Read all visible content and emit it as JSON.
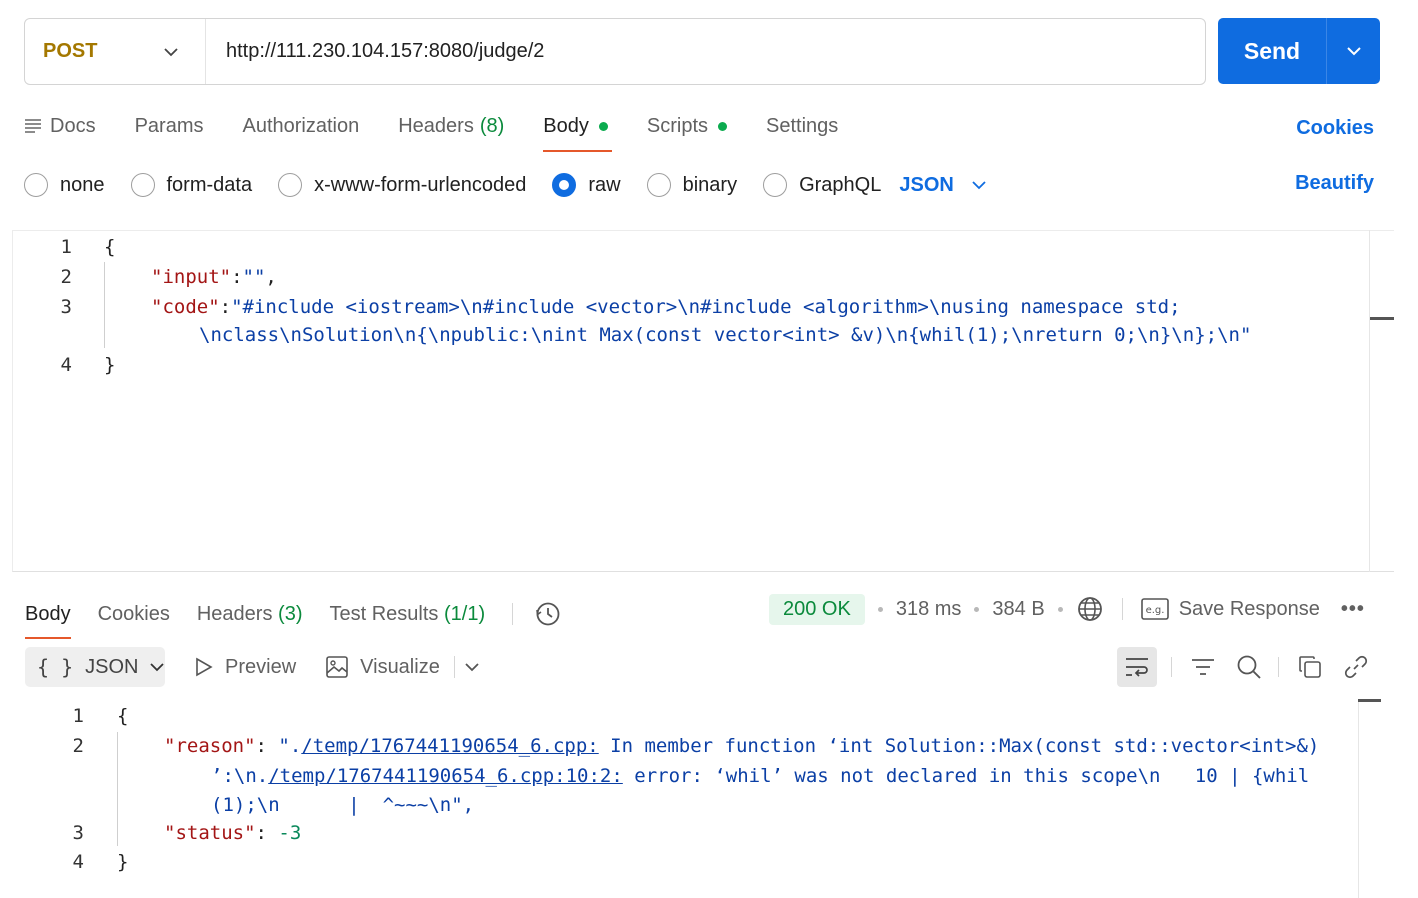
{
  "request": {
    "method": "POST",
    "url": "http://111.230.104.157:8080/judge/2",
    "send_label": "Send"
  },
  "request_tabs": [
    {
      "label": "Docs"
    },
    {
      "label": "Params"
    },
    {
      "label": "Authorization"
    },
    {
      "label": "Headers",
      "count": "(8)"
    },
    {
      "label": "Body",
      "active": true
    },
    {
      "label": "Scripts"
    },
    {
      "label": "Settings"
    }
  ],
  "cookies_label": "Cookies",
  "body_types": {
    "none": "none",
    "form_data": "form-data",
    "urlencoded": "x-www-form-urlencoded",
    "raw": "raw",
    "binary": "binary",
    "graphql": "GraphQL",
    "selected": "raw",
    "language": "JSON"
  },
  "beautify_label": "Beautify",
  "request_body": {
    "line_numbers": [
      "1",
      "2",
      "3",
      "4"
    ],
    "open_brace": "{",
    "close_brace": "}",
    "input_key": "\"input\"",
    "input_colon": ":",
    "input_value": "\"\"",
    "input_comma": ",",
    "code_key": "\"code\"",
    "code_colon": ":",
    "code_value_line1": "\"#include <iostream>\\n#include <vector>\\n#include <algorithm>\\nusing namespace std;",
    "code_value_line2": "\\nclass\\nSolution\\n{\\npublic:\\nint Max(const vector<int> &v)\\n{whil(1);\\nreturn 0;\\n}\\n};\\n\""
  },
  "response_tabs": {
    "body": "Body",
    "cookies": "Cookies",
    "headers": "Headers",
    "headers_count": "(3)",
    "test_results": "Test Results",
    "test_results_count": "(1/1)"
  },
  "response_status": {
    "status": "200 OK",
    "time": "318 ms",
    "size": "384 B",
    "save_label": "Save Response",
    "more": "•••"
  },
  "response_toolbar": {
    "format": "JSON",
    "format_icon": "{ }",
    "preview": "Preview",
    "visualize": "Visualize"
  },
  "response_body": {
    "line_numbers": [
      "1",
      "2",
      "3",
      "4"
    ],
    "open_brace": "{",
    "close_brace": "}",
    "reason_key": "\"reason\"",
    "reason_colon": ": ",
    "reason_l1_a": "\".",
    "reason_l1_link": "/temp/1767441190654_6.cpp:",
    "reason_l1_b": " In member function ‘int Solution::Max(const std::vector<int>&)",
    "reason_l2_a": "’:\\n.",
    "reason_l2_link": "/temp/1767441190654_6.cpp:10:2:",
    "reason_l2_b": " error: ‘whil’ was not declared in this scope\\n   10 | {whil",
    "reason_l3": "(1);\\n      |  ^~~~\\n\",",
    "status_key": "\"status\"",
    "status_colon": ": ",
    "status_value": "-3"
  },
  "colors": {
    "accent_blue": "#0f6ce0",
    "method_color": "#a47800",
    "tab_underline": "#e5582b",
    "status_green": "#0b8a3c"
  }
}
